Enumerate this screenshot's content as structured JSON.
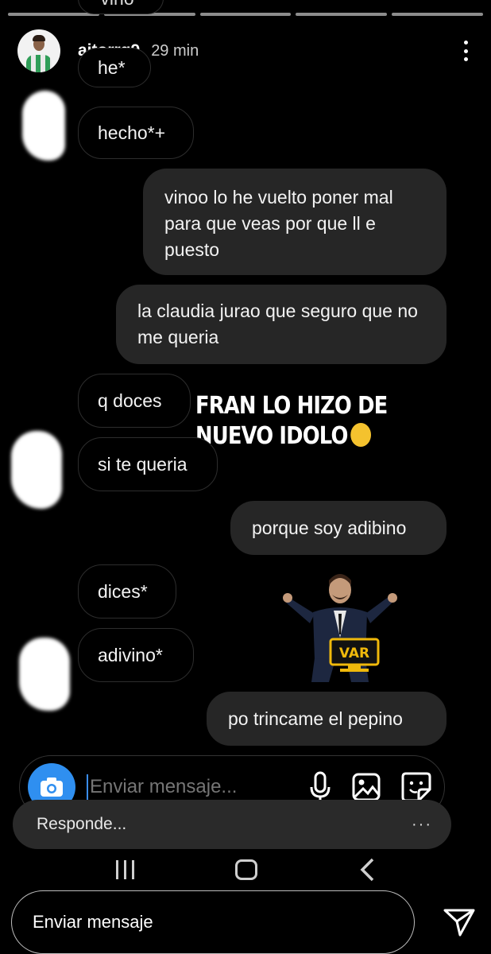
{
  "story": {
    "progress_segments": 5,
    "username": "aitorrg9",
    "time": "29 min"
  },
  "messages": [
    {
      "id": "m0",
      "text": "vino*",
      "side": "in"
    },
    {
      "id": "m1",
      "text": "he*",
      "side": "in"
    },
    {
      "id": "m2",
      "text": "hecho*+",
      "side": "in"
    },
    {
      "id": "m3",
      "text": "vinoo lo he vuelto poner mal para que veas por que ll e puesto",
      "side": "out"
    },
    {
      "id": "m4",
      "text": "la claudia jurao que seguro que no me queria",
      "side": "out"
    },
    {
      "id": "m5",
      "text": "q doces",
      "side": "in"
    },
    {
      "id": "m6",
      "text": "si te queria",
      "side": "in"
    },
    {
      "id": "m7",
      "text": "porque soy adibino",
      "side": "out"
    },
    {
      "id": "m8",
      "text": "dices*",
      "side": "in"
    },
    {
      "id": "m9",
      "text": "adivino*",
      "side": "in"
    },
    {
      "id": "m10",
      "text": "po trincame el pepino",
      "side": "out"
    }
  ],
  "caption": {
    "text": "FRAN LO HIZO DE NUEVO IDOLO",
    "emoji": "face-with-tears-of-joy"
  },
  "sticker": {
    "label": "VAR",
    "colors": {
      "badge": "#f0b90b",
      "suit": "#1d2740"
    }
  },
  "composer": {
    "placeholder": "Enviar mensaje...",
    "icons": [
      "camera-icon",
      "microphone-icon",
      "gallery-icon",
      "sticker-icon"
    ],
    "camera_color": "#2f8ff0"
  },
  "reply_overlay": {
    "label": "Responde...",
    "more": "···"
  },
  "navbar": {
    "icons": [
      "recents-icon",
      "home-icon",
      "back-icon"
    ]
  },
  "reply_bar": {
    "placeholder": "Enviar mensaje",
    "send_icon": "send-icon"
  }
}
